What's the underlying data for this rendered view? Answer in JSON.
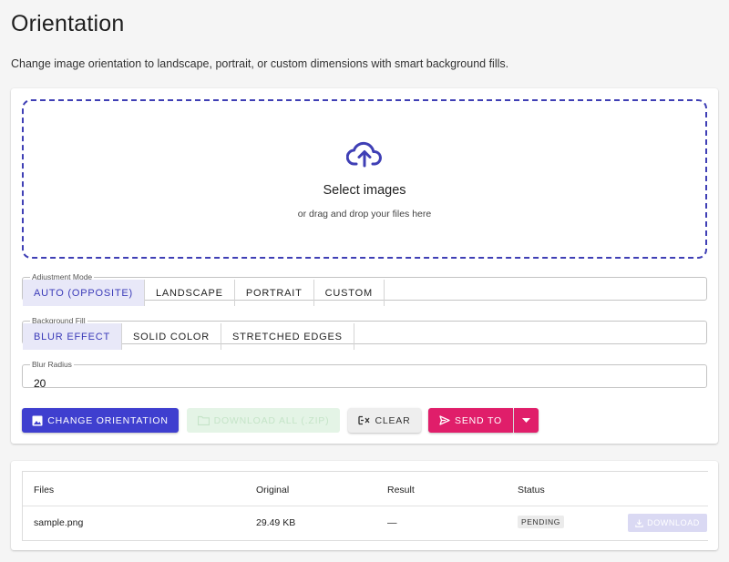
{
  "page": {
    "title": "Orientation",
    "description": "Change image orientation to landscape, portrait, or custom dimensions with smart background fills."
  },
  "upload": {
    "icon": "cloud-upload-icon",
    "title": "Select images",
    "subtitle": "or drag and drop your files here"
  },
  "adjustment_mode": {
    "legend": "Adjustment Mode",
    "options": [
      "AUTO (OPPOSITE)",
      "LANDSCAPE",
      "PORTRAIT",
      "CUSTOM"
    ],
    "selected": "AUTO (OPPOSITE)"
  },
  "background_fill": {
    "legend": "Background Fill",
    "options": [
      "BLUR EFFECT",
      "SOLID COLOR",
      "STRETCHED EDGES"
    ],
    "selected": "BLUR EFFECT"
  },
  "blur_radius": {
    "legend": "Blur Radius",
    "value": "20"
  },
  "actions": {
    "change_orientation": "CHANGE ORIENTATION",
    "download_all": "DOWNLOAD ALL (.ZIP)",
    "clear": "CLEAR",
    "send_to": "SEND TO"
  },
  "files_table": {
    "headers": [
      "Files",
      "Original",
      "Result",
      "Status"
    ],
    "rows": [
      {
        "file": "sample.png",
        "original": "29.49 KB",
        "result": "—",
        "status": "PENDING",
        "action": "DOWNLOAD"
      }
    ]
  },
  "colors": {
    "primary": "#3f3fcf",
    "accent": "#e01e6a",
    "dropzone_border": "#3f3fb5"
  }
}
